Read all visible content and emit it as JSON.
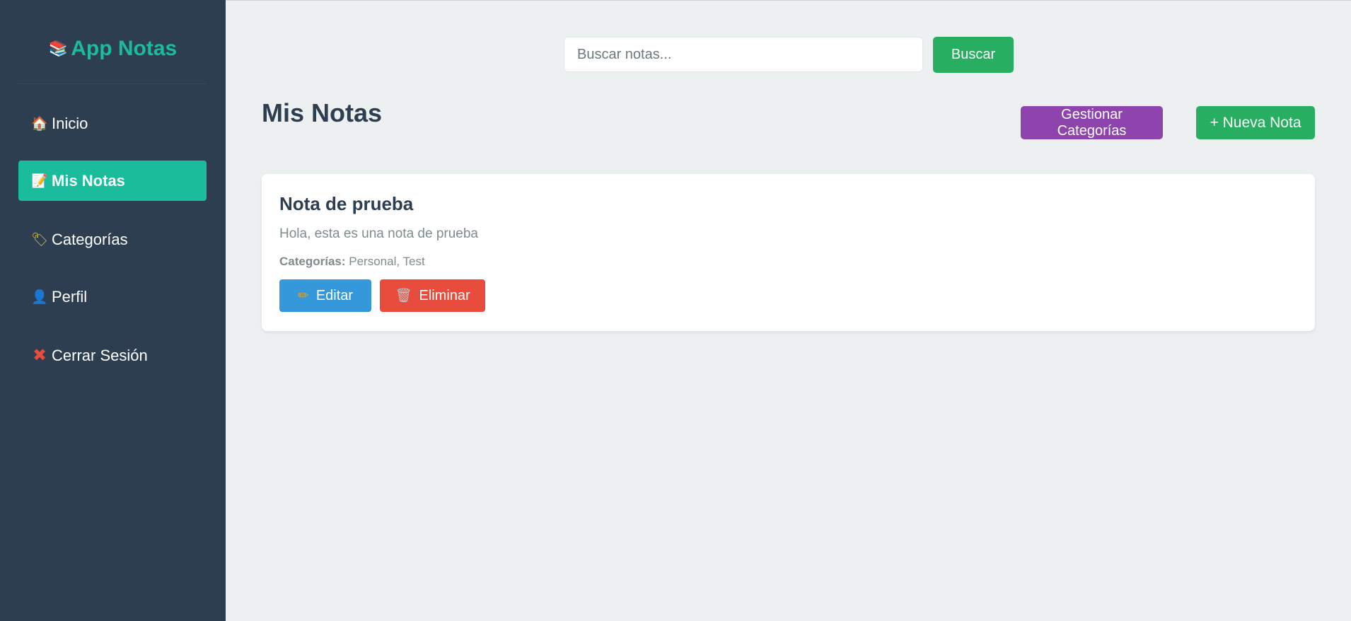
{
  "sidebar": {
    "brand": {
      "glyph": "📚",
      "title": "App Notas",
      "icon": "books-icon"
    },
    "items": [
      {
        "glyph": "🏠",
        "label": "Inicio",
        "icon": "house-icon",
        "active": false
      },
      {
        "glyph": "📝",
        "label": "Mis Notas",
        "icon": "memo-icon",
        "active": true
      },
      {
        "glyph": "🏷",
        "label": "Categorías",
        "icon": "tag-icon",
        "active": false
      },
      {
        "glyph": "👤",
        "label": "Perfil",
        "icon": "person-icon",
        "active": false
      },
      {
        "glyph": "✖",
        "label": "Cerrar Sesión",
        "icon": "close-icon",
        "active": false
      }
    ]
  },
  "search": {
    "placeholder": "Buscar notas...",
    "value": "",
    "button_label": "Buscar"
  },
  "header": {
    "title": "Mis Notas",
    "categories_button": "Gestionar Categorías",
    "new_note_button": "+ Nueva Nota"
  },
  "notes": [
    {
      "title": "Nota de prueba",
      "body": "Hola, esta es una nota de prueba",
      "categories_label": "Categorías:",
      "categories": "Personal, Test",
      "edit_glyph": "✏",
      "edit_label": "Editar",
      "delete_glyph": "🗑",
      "delete_label": "Eliminar"
    }
  ],
  "colors": {
    "sidebar_bg": "#2c3e50",
    "accent": "#1abc9c",
    "page_bg": "#ecf0f1",
    "green": "#27ae60",
    "purple": "#8e44ad",
    "blue": "#3498db",
    "red": "#e74c3c"
  }
}
